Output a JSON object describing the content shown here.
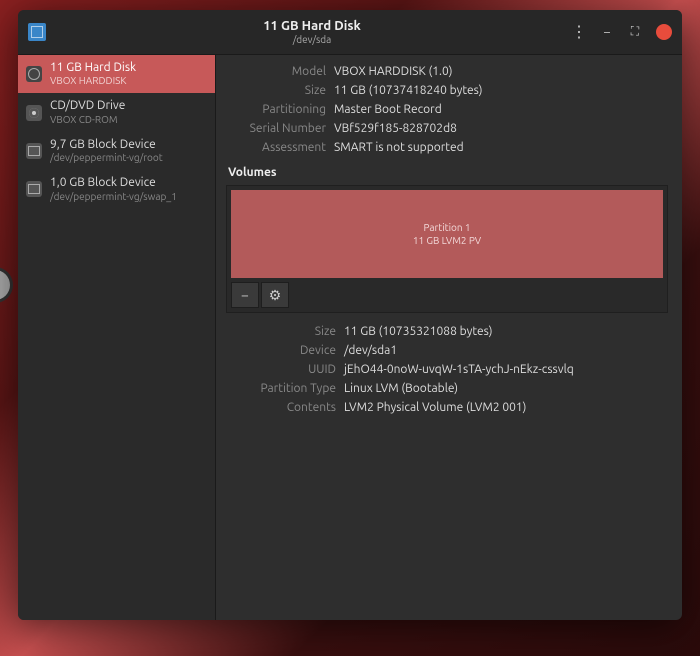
{
  "titlebar": {
    "title": "11 GB Hard Disk",
    "subtitle": "/dev/sda"
  },
  "sidebar": {
    "items": [
      {
        "title": "11 GB Hard Disk",
        "subtitle": "VBOX HARDDISK",
        "icon": "hdd",
        "selected": true
      },
      {
        "title": "CD/DVD Drive",
        "subtitle": "VBOX CD-ROM",
        "icon": "cd",
        "selected": false
      },
      {
        "title": "9,7 GB Block Device",
        "subtitle": "/dev/peppermint-vg/root",
        "icon": "block",
        "selected": false
      },
      {
        "title": "1,0 GB Block Device",
        "subtitle": "/dev/peppermint-vg/swap_1",
        "icon": "block",
        "selected": false
      }
    ]
  },
  "disk": {
    "model_label": "Model",
    "model_value": "VBOX HARDDISK (1.0)",
    "size_label": "Size",
    "size_value": "11 GB (10737418240 bytes)",
    "partitioning_label": "Partitioning",
    "partitioning_value": "Master Boot Record",
    "serial_label": "Serial Number",
    "serial_value": "VBf529f185-828702d8",
    "assessment_label": "Assessment",
    "assessment_value": "SMART is not supported"
  },
  "volumes_section": {
    "title": "Volumes",
    "partition_title": "Partition 1",
    "partition_sub": "11 GB LVM2 PV",
    "minus_label": "−",
    "gear_label": "⚙"
  },
  "partition": {
    "size_label": "Size",
    "size_value": "11 GB (10735321088 bytes)",
    "device_label": "Device",
    "device_value": "/dev/sda1",
    "uuid_label": "UUID",
    "uuid_value": "jEhO44-0noW-uvqW-1sTA-ychJ-nEkz-cssvlq",
    "ptype_label": "Partition Type",
    "ptype_value": "Linux LVM (Bootable)",
    "contents_label": "Contents",
    "contents_value": "LVM2 Physical Volume (LVM2 001)"
  }
}
